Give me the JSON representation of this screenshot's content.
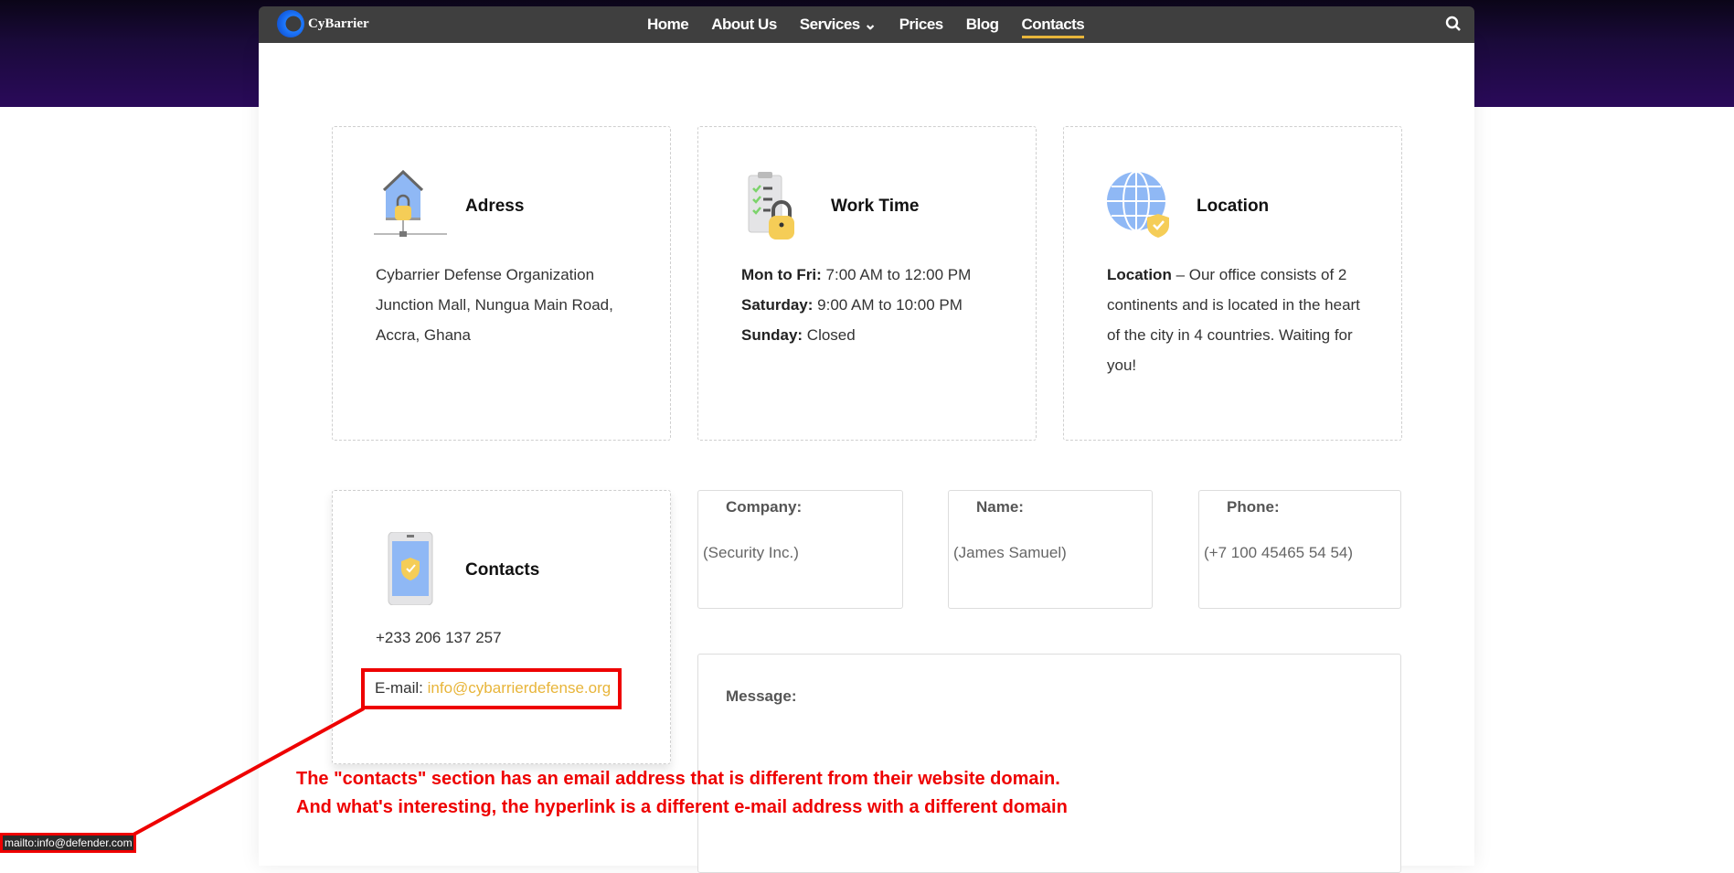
{
  "nav": {
    "logo": "CyBarrier",
    "items": [
      {
        "label": "Home"
      },
      {
        "label": "About Us"
      },
      {
        "label": "Services ⌄"
      },
      {
        "label": "Prices"
      },
      {
        "label": "Blog"
      },
      {
        "label": "Contacts"
      }
    ],
    "active": "Contacts"
  },
  "cards": {
    "address": {
      "title": "Adress",
      "lines": [
        "Cybarrier Defense Organization",
        "Junction Mall, Nungua Main Road,",
        "Accra, Ghana"
      ]
    },
    "work": {
      "title": "Work Time",
      "rows": [
        {
          "day": "Mon to Fri:",
          "time": " 7:00 AM to 12:00 PM"
        },
        {
          "day": "Saturday:",
          "time": " 9:00 AM to 10:00 PM"
        },
        {
          "day": "Sunday:",
          "time": " Closed"
        }
      ]
    },
    "location": {
      "title": "Location",
      "lead": "Location",
      "text": " – Our office consists of 2 continents and is located in the heart of the city in 4 countries. Waiting for you!"
    },
    "contacts": {
      "title": "Contacts",
      "phone": "+233 206 137 257",
      "email_label": "E-mail: ",
      "email": "info@cybarrierdefense.org"
    }
  },
  "form": {
    "company_label": "Company:",
    "company_value": "(Security Inc.)",
    "name_label": "Name:",
    "name_value": "(James Samuel)",
    "phone_label": "Phone:",
    "phone_value": "(+7 100 45465 54 54)",
    "message_label": "Message:"
  },
  "annotation": {
    "line1": "The \"contacts\" section has an email address that is different from their website domain.",
    "line2": "And what's interesting, the hyperlink is a different e-mail address with a different domain"
  },
  "status_bar": {
    "link": "mailto:info@defender.com"
  }
}
